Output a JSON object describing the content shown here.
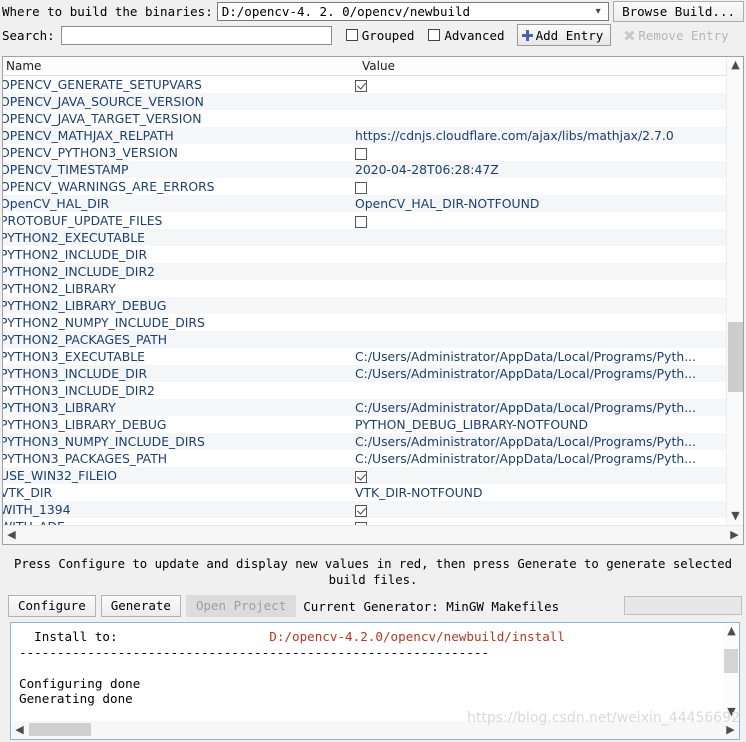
{
  "toolbar": {
    "build_label": "Where to build the binaries:",
    "build_path": "D:/opencv-4. 2. 0/opencv/newbuild",
    "browse_label": "Browse Build...",
    "search_label": "Search:",
    "search_value": "",
    "search_placeholder": "",
    "grouped_label": "Grouped",
    "grouped_checked": false,
    "advanced_label": "Advanced",
    "advanced_checked": false,
    "add_entry_label": "Add Entry",
    "remove_entry_label": "Remove Entry"
  },
  "table": {
    "col_name": "Name",
    "col_value": "Value",
    "rows": [
      {
        "name": "OPENCV_GENERATE_SETUPVARS",
        "type": "bool",
        "checked": true,
        "value": ""
      },
      {
        "name": "OPENCV_JAVA_SOURCE_VERSION",
        "type": "text",
        "value": ""
      },
      {
        "name": "OPENCV_JAVA_TARGET_VERSION",
        "type": "text",
        "value": ""
      },
      {
        "name": "OPENCV_MATHJAX_RELPATH",
        "type": "text",
        "value": "https://cdnjs.cloudflare.com/ajax/libs/mathjax/2.7.0"
      },
      {
        "name": "OPENCV_PYTHON3_VERSION",
        "type": "bool",
        "checked": false,
        "value": ""
      },
      {
        "name": "OPENCV_TIMESTAMP",
        "type": "text",
        "value": "2020-04-28T06:28:47Z"
      },
      {
        "name": "OPENCV_WARNINGS_ARE_ERRORS",
        "type": "bool",
        "checked": false,
        "value": ""
      },
      {
        "name": "OpenCV_HAL_DIR",
        "type": "text",
        "value": "OpenCV_HAL_DIR-NOTFOUND"
      },
      {
        "name": "PROTOBUF_UPDATE_FILES",
        "type": "bool",
        "checked": false,
        "value": ""
      },
      {
        "name": "PYTHON2_EXECUTABLE",
        "type": "text",
        "value": ""
      },
      {
        "name": "PYTHON2_INCLUDE_DIR",
        "type": "text",
        "value": ""
      },
      {
        "name": "PYTHON2_INCLUDE_DIR2",
        "type": "text",
        "value": ""
      },
      {
        "name": "PYTHON2_LIBRARY",
        "type": "text",
        "value": ""
      },
      {
        "name": "PYTHON2_LIBRARY_DEBUG",
        "type": "text",
        "value": ""
      },
      {
        "name": "PYTHON2_NUMPY_INCLUDE_DIRS",
        "type": "text",
        "value": ""
      },
      {
        "name": "PYTHON2_PACKAGES_PATH",
        "type": "text",
        "value": ""
      },
      {
        "name": "PYTHON3_EXECUTABLE",
        "type": "text",
        "value": "C:/Users/Administrator/AppData/Local/Programs/Pyth..."
      },
      {
        "name": "PYTHON3_INCLUDE_DIR",
        "type": "text",
        "value": "C:/Users/Administrator/AppData/Local/Programs/Pyth..."
      },
      {
        "name": "PYTHON3_INCLUDE_DIR2",
        "type": "text",
        "value": ""
      },
      {
        "name": "PYTHON3_LIBRARY",
        "type": "text",
        "value": "C:/Users/Administrator/AppData/Local/Programs/Pyth..."
      },
      {
        "name": "PYTHON3_LIBRARY_DEBUG",
        "type": "text",
        "value": "PYTHON_DEBUG_LIBRARY-NOTFOUND"
      },
      {
        "name": "PYTHON3_NUMPY_INCLUDE_DIRS",
        "type": "text",
        "value": "C:/Users/Administrator/AppData/Local/Programs/Pyth..."
      },
      {
        "name": "PYTHON3_PACKAGES_PATH",
        "type": "text",
        "value": "C:/Users/Administrator/AppData/Local/Programs/Pyth..."
      },
      {
        "name": "USE_WIN32_FILEIO",
        "type": "bool",
        "checked": true,
        "value": ""
      },
      {
        "name": "VTK_DIR",
        "type": "text",
        "value": "VTK_DIR-NOTFOUND"
      },
      {
        "name": "WITH_1394",
        "type": "bool",
        "checked": true,
        "value": ""
      },
      {
        "name": "WITH_ADE",
        "type": "bool",
        "checked": false,
        "value": ""
      }
    ]
  },
  "hint": "Press Configure to update and display new values in red, then press Generate to generate selected build files.",
  "actions": {
    "configure_label": "Configure",
    "generate_label": "Generate",
    "open_project_label": "Open Project",
    "generator_text": "Current Generator: MinGW Makefiles",
    "progress_value": ""
  },
  "log": {
    "line1_label": "  Install to:",
    "line1_path": "D:/opencv-4.2.0/opencv/newbuild/install",
    "line2": "--------------------------------------------------------------",
    "line3": "",
    "line4": "Configuring done",
    "line5": "Generating done"
  },
  "watermark": "https://blog.csdn.net/weixin_44456692"
}
